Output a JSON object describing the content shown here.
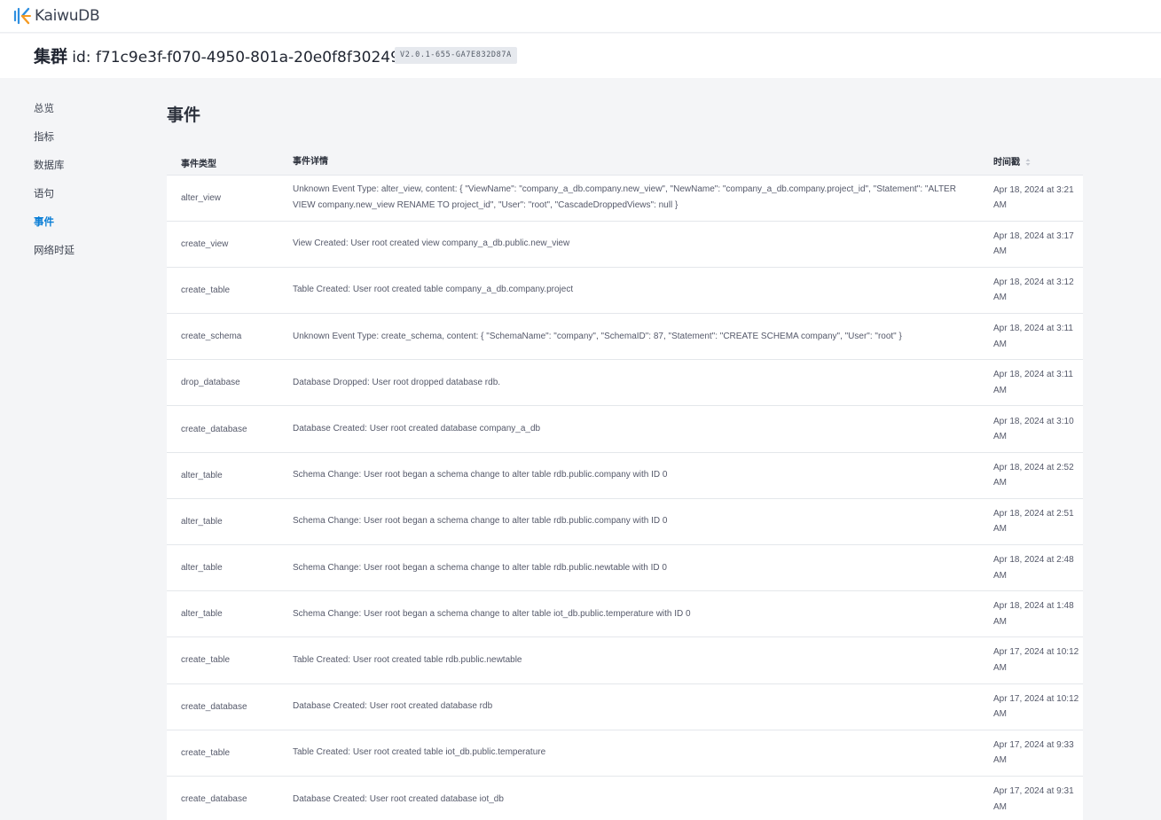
{
  "brand": {
    "name": "KaiwuDB"
  },
  "cluster": {
    "label": "集群",
    "id_text": "id: f71c9e3f-f070-4950-801a-20e0f8f30249",
    "version": "V2.0.1-655-GA7E832D87A"
  },
  "sidebar": {
    "items": [
      {
        "label": "总览",
        "active": false
      },
      {
        "label": "指标",
        "active": false
      },
      {
        "label": "数据库",
        "active": false
      },
      {
        "label": "语句",
        "active": false
      },
      {
        "label": "事件",
        "active": true
      },
      {
        "label": "网络时延",
        "active": false
      }
    ]
  },
  "page": {
    "title": "事件"
  },
  "table": {
    "headers": {
      "type": "事件类型",
      "detail": "事件详情",
      "time": "时间戳"
    },
    "rows": [
      {
        "type": "alter_view",
        "detail": "Unknown Event Type: alter_view, content: { \"ViewName\": \"company_a_db.company.new_view\", \"NewName\": \"company_a_db.company.project_id\", \"Statement\": \"ALTER VIEW company.new_view RENAME TO project_id\", \"User\": \"root\", \"CascadeDroppedViews\": null }",
        "time": "Apr 18, 2024 at 3:21 AM"
      },
      {
        "type": "create_view",
        "detail": "View Created: User root created view company_a_db.public.new_view",
        "time": "Apr 18, 2024 at 3:17 AM"
      },
      {
        "type": "create_table",
        "detail": "Table Created: User root created table company_a_db.company.project",
        "time": "Apr 18, 2024 at 3:12 AM"
      },
      {
        "type": "create_schema",
        "detail": "Unknown Event Type: create_schema, content: { \"SchemaName\": \"company\", \"SchemaID\": 87, \"Statement\": \"CREATE SCHEMA company\", \"User\": \"root\" }",
        "time": "Apr 18, 2024 at 3:11 AM"
      },
      {
        "type": "drop_database",
        "detail": "Database Dropped: User root dropped database rdb.",
        "time": "Apr 18, 2024 at 3:11 AM"
      },
      {
        "type": "create_database",
        "detail": "Database Created: User root created database company_a_db",
        "time": "Apr 18, 2024 at 3:10 AM"
      },
      {
        "type": "alter_table",
        "detail": "Schema Change: User root began a schema change to alter table rdb.public.company with ID 0",
        "time": "Apr 18, 2024 at 2:52 AM"
      },
      {
        "type": "alter_table",
        "detail": "Schema Change: User root began a schema change to alter table rdb.public.company with ID 0",
        "time": "Apr 18, 2024 at 2:51 AM"
      },
      {
        "type": "alter_table",
        "detail": "Schema Change: User root began a schema change to alter table rdb.public.newtable with ID 0",
        "time": "Apr 18, 2024 at 2:48 AM"
      },
      {
        "type": "alter_table",
        "detail": "Schema Change: User root began a schema change to alter table iot_db.public.temperature with ID 0",
        "time": "Apr 18, 2024 at 1:48 AM"
      },
      {
        "type": "create_table",
        "detail": "Table Created: User root created table rdb.public.newtable",
        "time": "Apr 17, 2024 at 10:12 AM"
      },
      {
        "type": "create_database",
        "detail": "Database Created: User root created database rdb",
        "time": "Apr 17, 2024 at 10:12 AM"
      },
      {
        "type": "create_table",
        "detail": "Table Created: User root created table iot_db.public.temperature",
        "time": "Apr 17, 2024 at 9:33 AM"
      },
      {
        "type": "create_database",
        "detail": "Database Created: User root created database iot_db",
        "time": "Apr 17, 2024 at 9:31 AM"
      }
    ]
  },
  "colors": {
    "accent": "#0a7ed6",
    "logo_blue": "#2e8fe0",
    "logo_orange": "#f59a23"
  },
  "icons": {
    "brand": "kaiwudb-logo-icon",
    "sort": "sort-icon"
  }
}
